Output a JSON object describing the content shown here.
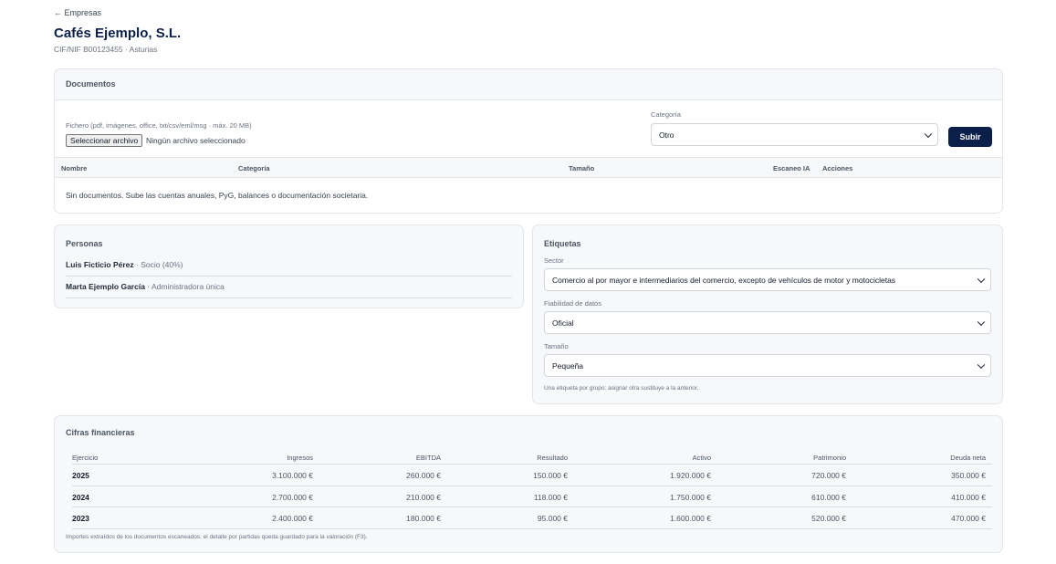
{
  "nav": {
    "back_label": "← Empresas"
  },
  "company": {
    "name": "Cafés Ejemplo, S.L.",
    "meta": "CIF/NIF B00123455 · Asturias"
  },
  "documents": {
    "title": "Documentos",
    "file_hint": "Fichero (pdf, imágenes, office, txt/csv/eml/msg · máx. 20 MB)",
    "file_button": "Seleccionar archivo",
    "file_none": "Ningún archivo seleccionado",
    "category_label": "Categoría",
    "category_value": "Otro",
    "upload_button": "Subir",
    "columns": [
      "Nombre",
      "Categoría",
      "Tamaño",
      "Escaneo IA",
      "Acciones"
    ],
    "empty": "Sin documentos. Sube las cuentas anuales, PyG, balances o documentación societaria."
  },
  "persons": {
    "title": "Personas",
    "items": [
      {
        "name": "Luis Ficticio Pérez",
        "role": " · Socio (40%)"
      },
      {
        "name": "Marta Ejemplo García",
        "role": " · Administradora única"
      }
    ]
  },
  "tags": {
    "title": "Etiquetas",
    "sector_label": "Sector",
    "sector_value": "Comercio al por mayor e intermediarios del comercio, excepto de vehículos de motor y motocicletas",
    "reliability_label": "Fiabilidad de datos",
    "reliability_value": "Oficial",
    "size_label": "Tamaño",
    "size_value": "Pequeña",
    "note": "Una etiqueta por grupo: asignar otra sustituye a la anterior."
  },
  "financials": {
    "title": "Cifras financieras",
    "columns": [
      "Ejercicio",
      "Ingresos",
      "EBITDA",
      "Resultado",
      "Activo",
      "Patrimonio",
      "Deuda neta"
    ],
    "rows": [
      [
        "2025",
        "3.100.000 €",
        "260.000 €",
        "150.000 €",
        "1.920.000 €",
        "720.000 €",
        "350.000 €"
      ],
      [
        "2024",
        "2.700.000 €",
        "210.000 €",
        "118.000 €",
        "1.750.000 €",
        "610.000 €",
        "410.000 €"
      ],
      [
        "2023",
        "2.400.000 €",
        "180.000 €",
        "95.000 €",
        "1.600.000 €",
        "520.000 €",
        "470.000 €"
      ]
    ],
    "note": "Importes extraídos de los documentos escaneados; el detalle por partidas queda guardado para la valoración (F3)."
  },
  "colors": {
    "primary": "#0b1f4b",
    "card_bg": "#f7f8fa",
    "border": "#e2e5ea"
  },
  "icons": {
    "select_arrow": "chevron-down-icon"
  }
}
